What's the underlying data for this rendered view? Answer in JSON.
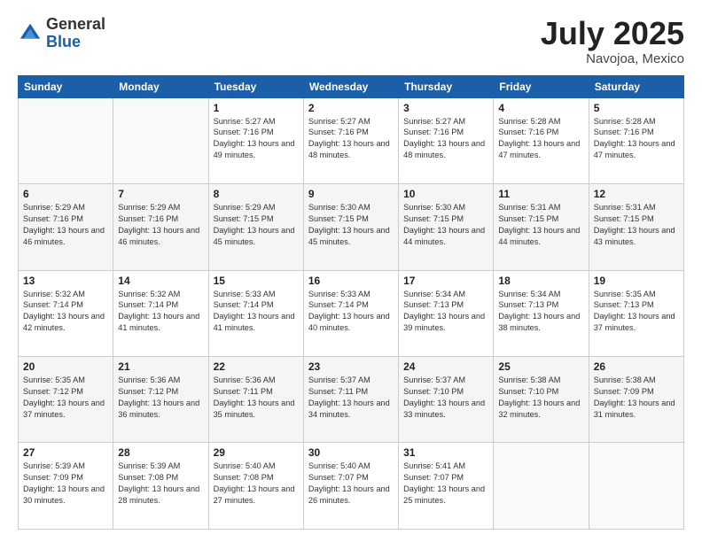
{
  "header": {
    "logo_general": "General",
    "logo_blue": "Blue",
    "month_title": "July 2025",
    "location": "Navojoa, Mexico"
  },
  "days_of_week": [
    "Sunday",
    "Monday",
    "Tuesday",
    "Wednesday",
    "Thursday",
    "Friday",
    "Saturday"
  ],
  "weeks": [
    [
      {
        "day": "",
        "text": ""
      },
      {
        "day": "",
        "text": ""
      },
      {
        "day": "1",
        "text": "Sunrise: 5:27 AM\nSunset: 7:16 PM\nDaylight: 13 hours and 49 minutes."
      },
      {
        "day": "2",
        "text": "Sunrise: 5:27 AM\nSunset: 7:16 PM\nDaylight: 13 hours and 48 minutes."
      },
      {
        "day": "3",
        "text": "Sunrise: 5:27 AM\nSunset: 7:16 PM\nDaylight: 13 hours and 48 minutes."
      },
      {
        "day": "4",
        "text": "Sunrise: 5:28 AM\nSunset: 7:16 PM\nDaylight: 13 hours and 47 minutes."
      },
      {
        "day": "5",
        "text": "Sunrise: 5:28 AM\nSunset: 7:16 PM\nDaylight: 13 hours and 47 minutes."
      }
    ],
    [
      {
        "day": "6",
        "text": "Sunrise: 5:29 AM\nSunset: 7:16 PM\nDaylight: 13 hours and 46 minutes."
      },
      {
        "day": "7",
        "text": "Sunrise: 5:29 AM\nSunset: 7:16 PM\nDaylight: 13 hours and 46 minutes."
      },
      {
        "day": "8",
        "text": "Sunrise: 5:29 AM\nSunset: 7:15 PM\nDaylight: 13 hours and 45 minutes."
      },
      {
        "day": "9",
        "text": "Sunrise: 5:30 AM\nSunset: 7:15 PM\nDaylight: 13 hours and 45 minutes."
      },
      {
        "day": "10",
        "text": "Sunrise: 5:30 AM\nSunset: 7:15 PM\nDaylight: 13 hours and 44 minutes."
      },
      {
        "day": "11",
        "text": "Sunrise: 5:31 AM\nSunset: 7:15 PM\nDaylight: 13 hours and 44 minutes."
      },
      {
        "day": "12",
        "text": "Sunrise: 5:31 AM\nSunset: 7:15 PM\nDaylight: 13 hours and 43 minutes."
      }
    ],
    [
      {
        "day": "13",
        "text": "Sunrise: 5:32 AM\nSunset: 7:14 PM\nDaylight: 13 hours and 42 minutes."
      },
      {
        "day": "14",
        "text": "Sunrise: 5:32 AM\nSunset: 7:14 PM\nDaylight: 13 hours and 41 minutes."
      },
      {
        "day": "15",
        "text": "Sunrise: 5:33 AM\nSunset: 7:14 PM\nDaylight: 13 hours and 41 minutes."
      },
      {
        "day": "16",
        "text": "Sunrise: 5:33 AM\nSunset: 7:14 PM\nDaylight: 13 hours and 40 minutes."
      },
      {
        "day": "17",
        "text": "Sunrise: 5:34 AM\nSunset: 7:13 PM\nDaylight: 13 hours and 39 minutes."
      },
      {
        "day": "18",
        "text": "Sunrise: 5:34 AM\nSunset: 7:13 PM\nDaylight: 13 hours and 38 minutes."
      },
      {
        "day": "19",
        "text": "Sunrise: 5:35 AM\nSunset: 7:13 PM\nDaylight: 13 hours and 37 minutes."
      }
    ],
    [
      {
        "day": "20",
        "text": "Sunrise: 5:35 AM\nSunset: 7:12 PM\nDaylight: 13 hours and 37 minutes."
      },
      {
        "day": "21",
        "text": "Sunrise: 5:36 AM\nSunset: 7:12 PM\nDaylight: 13 hours and 36 minutes."
      },
      {
        "day": "22",
        "text": "Sunrise: 5:36 AM\nSunset: 7:11 PM\nDaylight: 13 hours and 35 minutes."
      },
      {
        "day": "23",
        "text": "Sunrise: 5:37 AM\nSunset: 7:11 PM\nDaylight: 13 hours and 34 minutes."
      },
      {
        "day": "24",
        "text": "Sunrise: 5:37 AM\nSunset: 7:10 PM\nDaylight: 13 hours and 33 minutes."
      },
      {
        "day": "25",
        "text": "Sunrise: 5:38 AM\nSunset: 7:10 PM\nDaylight: 13 hours and 32 minutes."
      },
      {
        "day": "26",
        "text": "Sunrise: 5:38 AM\nSunset: 7:09 PM\nDaylight: 13 hours and 31 minutes."
      }
    ],
    [
      {
        "day": "27",
        "text": "Sunrise: 5:39 AM\nSunset: 7:09 PM\nDaylight: 13 hours and 30 minutes."
      },
      {
        "day": "28",
        "text": "Sunrise: 5:39 AM\nSunset: 7:08 PM\nDaylight: 13 hours and 28 minutes."
      },
      {
        "day": "29",
        "text": "Sunrise: 5:40 AM\nSunset: 7:08 PM\nDaylight: 13 hours and 27 minutes."
      },
      {
        "day": "30",
        "text": "Sunrise: 5:40 AM\nSunset: 7:07 PM\nDaylight: 13 hours and 26 minutes."
      },
      {
        "day": "31",
        "text": "Sunrise: 5:41 AM\nSunset: 7:07 PM\nDaylight: 13 hours and 25 minutes."
      },
      {
        "day": "",
        "text": ""
      },
      {
        "day": "",
        "text": ""
      }
    ]
  ]
}
